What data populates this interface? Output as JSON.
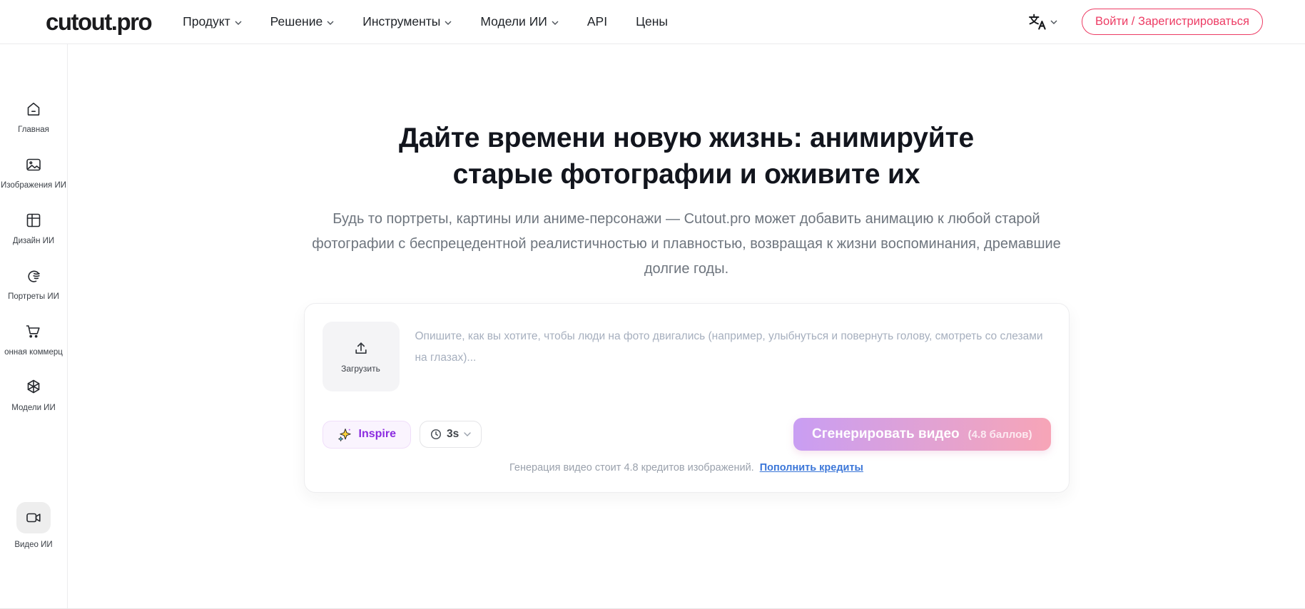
{
  "brand": {
    "logo": "cutout.pro"
  },
  "navbar": {
    "items": [
      {
        "label": "Продукт",
        "has_dropdown": true
      },
      {
        "label": "Решение",
        "has_dropdown": true
      },
      {
        "label": "Инструменты",
        "has_dropdown": true
      },
      {
        "label": "Модели ИИ",
        "has_dropdown": true
      },
      {
        "label": "API",
        "has_dropdown": false
      },
      {
        "label": "Цены",
        "has_dropdown": false
      }
    ],
    "language_icon": "translate-icon",
    "login_label": "Войти / Зарегистрироваться"
  },
  "sidebar": {
    "items": [
      {
        "label": "Главная",
        "icon": "home-icon",
        "active": false
      },
      {
        "label": "Изображения ИИ",
        "icon": "image-icon",
        "active": false
      },
      {
        "label": "Дизайн ИИ",
        "icon": "design-icon",
        "active": false
      },
      {
        "label": "Портреты ИИ",
        "icon": "portrait-icon",
        "active": false
      },
      {
        "label": "онная коммерц",
        "icon": "cart-icon",
        "active": false
      },
      {
        "label": "Модели ИИ",
        "icon": "cube-icon",
        "active": false
      },
      {
        "label": "Видео ИИ",
        "icon": "video-icon",
        "active": true
      }
    ]
  },
  "hero": {
    "title_line1": "Дайте времени новую жизнь: анимируйте",
    "title_line2": "старые фотографии и оживите их",
    "subtitle": "Будь то портреты, картины или аниме-персонажи — Cutout.pro может добавить анимацию к любой старой фотографии с беспрецедентной реалистичностью и плавностью, возвращая к жизни воспоминания, дремавшие долгие годы."
  },
  "composer": {
    "upload_label": "Загрузить",
    "prompt_placeholder": "Опишите, как вы хотите, чтобы люди на фото двигались (например, улыбнуться и повернуть голову, смотреть со слезами на глазах)...",
    "prompt_value": "",
    "inspire_label": "Inspire",
    "duration_label": "3s",
    "generate_label": "Сгенерировать видео",
    "generate_cost": "(4.8 баллов)",
    "credit_note": "Генерация видео стоит 4.8 кредитов изображений.",
    "credit_link": "Пополнить кредиты"
  },
  "colors": {
    "accent_pink": "#ed3c64",
    "accent_purple": "#8b2ce0",
    "gradient_start": "#c99ef3",
    "gradient_end": "#f7a5b7",
    "link_blue": "#3b76d8",
    "heading": "#12151d",
    "subtitle_gray": "#6e757e",
    "placeholder_gray": "#a6afbe"
  }
}
